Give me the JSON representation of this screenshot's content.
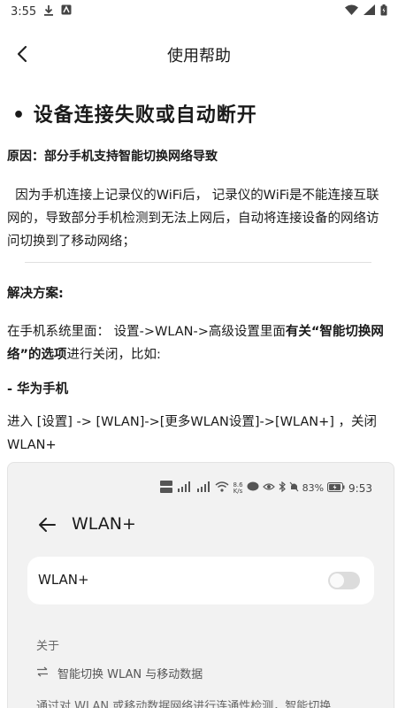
{
  "status_bar": {
    "time": "3:55",
    "icons": [
      "download-icon",
      "app-notification-icon",
      "wifi-icon",
      "signal-icon",
      "battery-icon"
    ]
  },
  "app_bar": {
    "title": "使用帮助",
    "back_icon": "chevron-left-icon"
  },
  "article": {
    "section_title": "• 设备连接失败或自动断开",
    "reason": "原因：部分手机支持智能切换网络导致",
    "paragraph": "  因为手机连接上记录仪的WiFi后， 记录仪的WiFi是不能连接互联网的，导致部分手机检测到无法上网后，自动将连接设备的网络访问切换到了移动网络；",
    "solution_title": "解决方案:",
    "solution_text_prefix": "在手机系统里面： 设置->WLAN->高级设置里面",
    "solution_text_bold": "有关“智能切换网络”的选项",
    "solution_text_suffix": "进行关闭，比如:",
    "brand_title": "- 华为手机",
    "instruction": "进入 [设置] -> [WLAN]->[更多WLAN设置]->[WLAN+] ，关闭WLAN+"
  },
  "embedded_screenshot": {
    "status": {
      "net_speed_top": "8.6",
      "net_speed_bottom": "K/s",
      "battery": "83%",
      "time": "9:53"
    },
    "title": "WLAN+",
    "card_label": "WLAN+",
    "toggle_state": "off",
    "about_label": "关于",
    "feature_label": "智能切换 WLAN 与移动数据",
    "feature_desc": "通过对 WLAN 或移动数据网络进行连通性检测，智能切换"
  }
}
